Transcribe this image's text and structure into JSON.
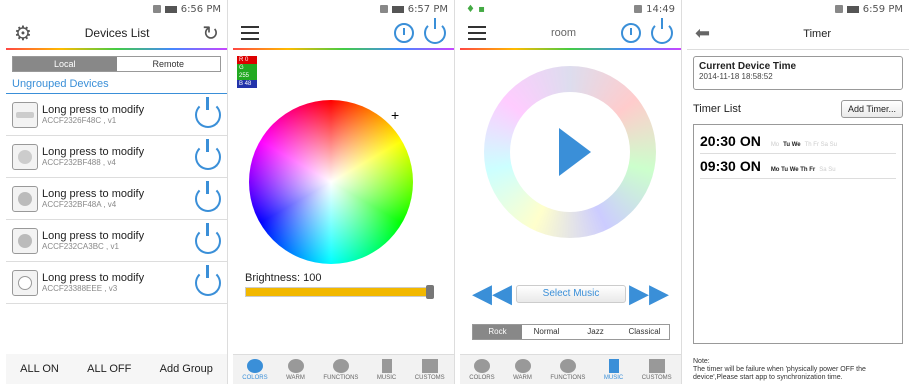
{
  "screen1": {
    "time": "6:56 PM",
    "title": "Devices List",
    "tabs": [
      "Local",
      "Remote"
    ],
    "group_header": "Ungrouped Devices",
    "devices": [
      {
        "name": "Long press to modify",
        "mac": "ACCF2326F48C , v1"
      },
      {
        "name": "Long press to modify",
        "mac": "ACCF232BF488 , v4"
      },
      {
        "name": "Long press to modify",
        "mac": "ACCF232BF48A , v4"
      },
      {
        "name": "Long press to modify",
        "mac": "ACCF232CA3BC , v1"
      },
      {
        "name": "Long press to modify",
        "mac": "ACCF23388EEE , v3"
      }
    ],
    "footer": [
      "ALL ON",
      "ALL OFF",
      "Add Group"
    ]
  },
  "screen2": {
    "time": "6:57 PM",
    "rgb": [
      "R 0",
      "G 255",
      "B 48"
    ],
    "brightness_label": "Brightness: 100",
    "brightness": 100,
    "tabs": [
      "COLORS",
      "WARM",
      "FUNCTIONS",
      "MUSIC",
      "CUSTOMS"
    ]
  },
  "screen3": {
    "time": "14:49",
    "title": "room",
    "select_music": "Select Music",
    "genres": [
      "Rock",
      "Normal",
      "Jazz",
      "Classical"
    ],
    "tabs": [
      "COLORS",
      "WARM",
      "FUNCTIONS",
      "MUSIC",
      "CUSTOMS"
    ]
  },
  "screen4": {
    "time": "6:59 PM",
    "title": "Timer",
    "current_label": "Current Device Time",
    "current_time": "2014-11-18 18:58:52",
    "list_label": "Timer List",
    "add_timer": "Add Timer...",
    "timers": [
      {
        "time": "20:30",
        "state": "ON",
        "days_off1": "Mo",
        "days_on": "Tu We",
        "days_off2": "Th Fr Sa Su"
      },
      {
        "time": "09:30",
        "state": "ON",
        "days_off1": "",
        "days_on": "Mo Tu We Th Fr",
        "days_off2": "Sa Su"
      }
    ],
    "note": "Note:\nThe timer will be failure when 'physically power OFF the device',Please start app to synchronization time."
  }
}
